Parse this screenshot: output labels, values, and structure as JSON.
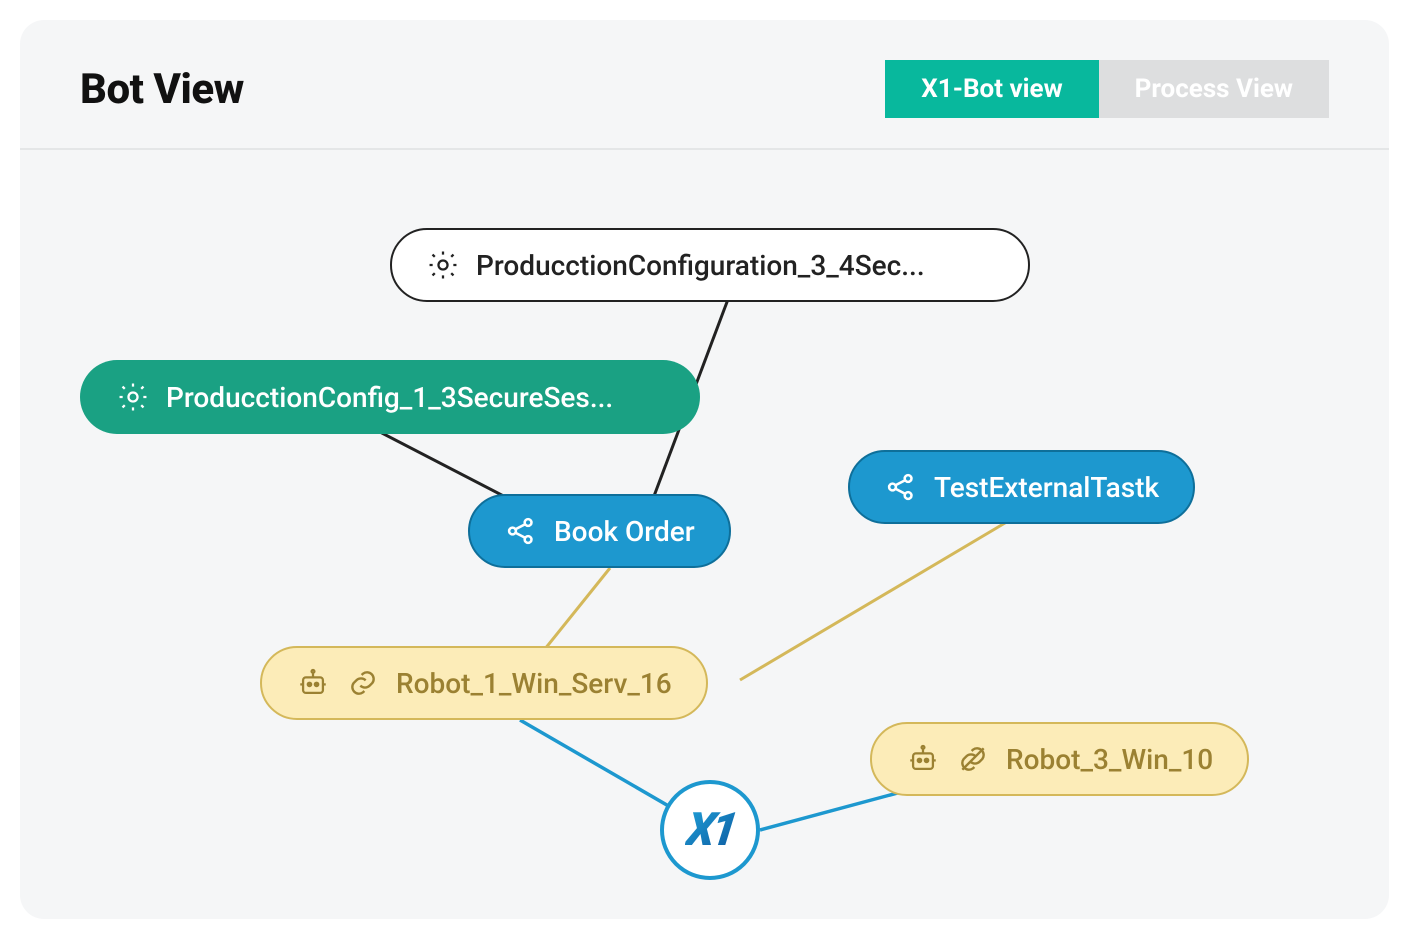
{
  "header": {
    "title": "Bot View",
    "tabs": [
      {
        "label": "X1-Bot view",
        "active": true
      },
      {
        "label": "Process View",
        "active": false
      }
    ]
  },
  "nodes": {
    "config_top": {
      "label": "ProducctionConfiguration_3_4Sec...",
      "type": "config",
      "style": "white"
    },
    "config_left": {
      "label": "ProducctionConfig_1_3SecureSes...",
      "type": "config",
      "style": "teal"
    },
    "task_book": {
      "label": "Book Order",
      "type": "task",
      "style": "blue"
    },
    "task_ext": {
      "label": "TestExternalTastk",
      "type": "task",
      "style": "blue"
    },
    "robot_1": {
      "label": "Robot_1_Win_Serv_16",
      "type": "robot",
      "style": "yellow",
      "linked": true
    },
    "robot_3": {
      "label": "Robot_3_Win_10",
      "type": "robot",
      "style": "yellow",
      "linked": false
    }
  },
  "hub": {
    "label": "X1"
  },
  "edges": [
    {
      "from": "config_top",
      "to": "task_book",
      "color": "#222"
    },
    {
      "from": "config_left",
      "to": "task_book",
      "color": "#222"
    },
    {
      "from": "task_book",
      "to": "robot_1",
      "color": "#d4b85a"
    },
    {
      "from": "task_ext",
      "to": "robot_1",
      "color": "#d4b85a"
    },
    {
      "from": "robot_1",
      "to": "hub",
      "color": "#1d98cf"
    },
    {
      "from": "robot_3",
      "to": "hub",
      "color": "#1d98cf"
    }
  ],
  "colors": {
    "teal": "#1aa183",
    "blue": "#1d98cf",
    "yellow_bg": "#fcecb8",
    "yellow_border": "#d4b85a",
    "yellow_text": "#9b8132"
  }
}
